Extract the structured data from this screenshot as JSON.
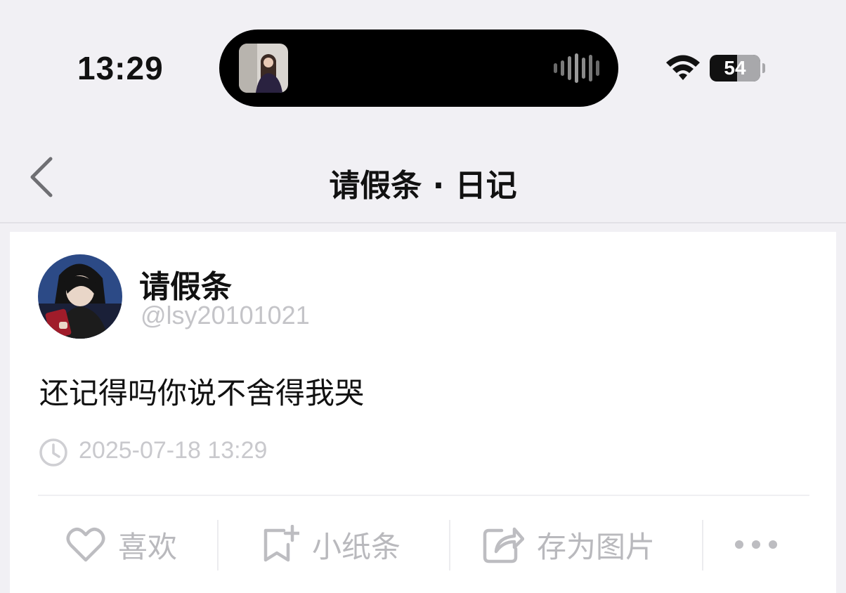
{
  "status_bar": {
    "time": "13:29",
    "battery_percent": "54",
    "battery_level": 0.54
  },
  "nav": {
    "title": "请假条 · 日记"
  },
  "post": {
    "author_name": "请假条",
    "author_handle": "@lsy20101021",
    "body": "还记得吗你说不舍得我哭",
    "timestamp": "2025-07-18 13:29"
  },
  "actions": {
    "like_label": "喜欢",
    "note_label": "小纸条",
    "save_image_label": "存为图片",
    "icons": [
      "heart-icon",
      "note-add-icon",
      "share-icon",
      "more-icon"
    ]
  },
  "colors": {
    "background": "#f1f0f4",
    "card": "#ffffff",
    "muted_text": "#b9b9bd"
  }
}
